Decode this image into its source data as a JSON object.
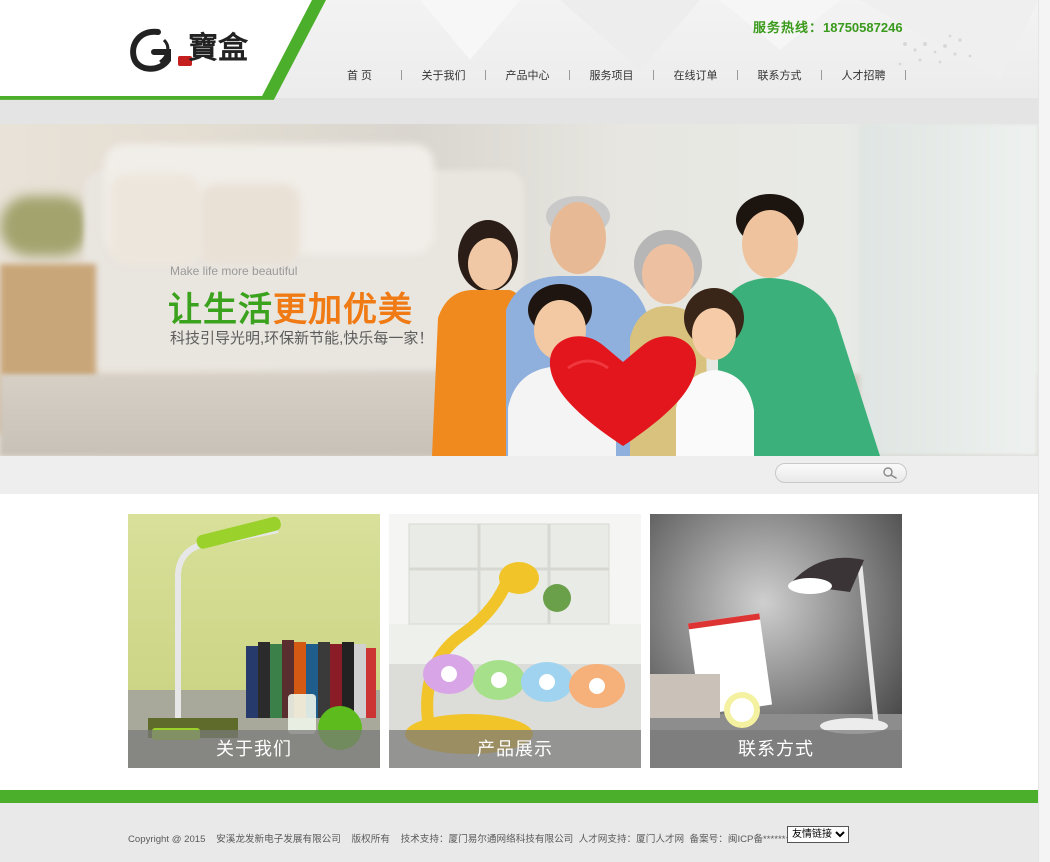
{
  "header": {
    "logo_text": "G寶盒",
    "hotline_label": "服务热线：",
    "hotline_number": "18750587246",
    "nav": [
      {
        "label": "首 页",
        "name": "nav-home"
      },
      {
        "label": "关于我们",
        "name": "nav-about"
      },
      {
        "label": "产品中心",
        "name": "nav-products"
      },
      {
        "label": "服务项目",
        "name": "nav-services"
      },
      {
        "label": "在线订单",
        "name": "nav-order"
      },
      {
        "label": "联系方式",
        "name": "nav-contact"
      },
      {
        "label": "人才招聘",
        "name": "nav-jobs"
      }
    ]
  },
  "banner": {
    "english": "Make life more beautiful",
    "title_green": "让生活",
    "title_orange": "更加优美",
    "subtitle": "科技引导光明,环保新节能,快乐每一家！"
  },
  "search": {
    "placeholder": "",
    "icon": "search-icon"
  },
  "tiles": [
    {
      "caption": "关于我们",
      "name": "tile-about"
    },
    {
      "caption": "产品展示",
      "name": "tile-products"
    },
    {
      "caption": "联系方式",
      "name": "tile-contact"
    }
  ],
  "footer": {
    "copyright": "Copyright @ 2015",
    "company": "安溪龙发新电子发展有限公司",
    "rights": "版权所有",
    "tech_support": "技术支持：厦门易尔通网络科技有限公司",
    "talent_support": "人才网支持：厦门人才网",
    "icp": "备案号：闽ICP备******号",
    "links_select": "友情链接"
  },
  "colors": {
    "brand_green": "#4caf2b",
    "accent_orange": "#f07a13",
    "hotline_green": "#3a9a1c"
  }
}
